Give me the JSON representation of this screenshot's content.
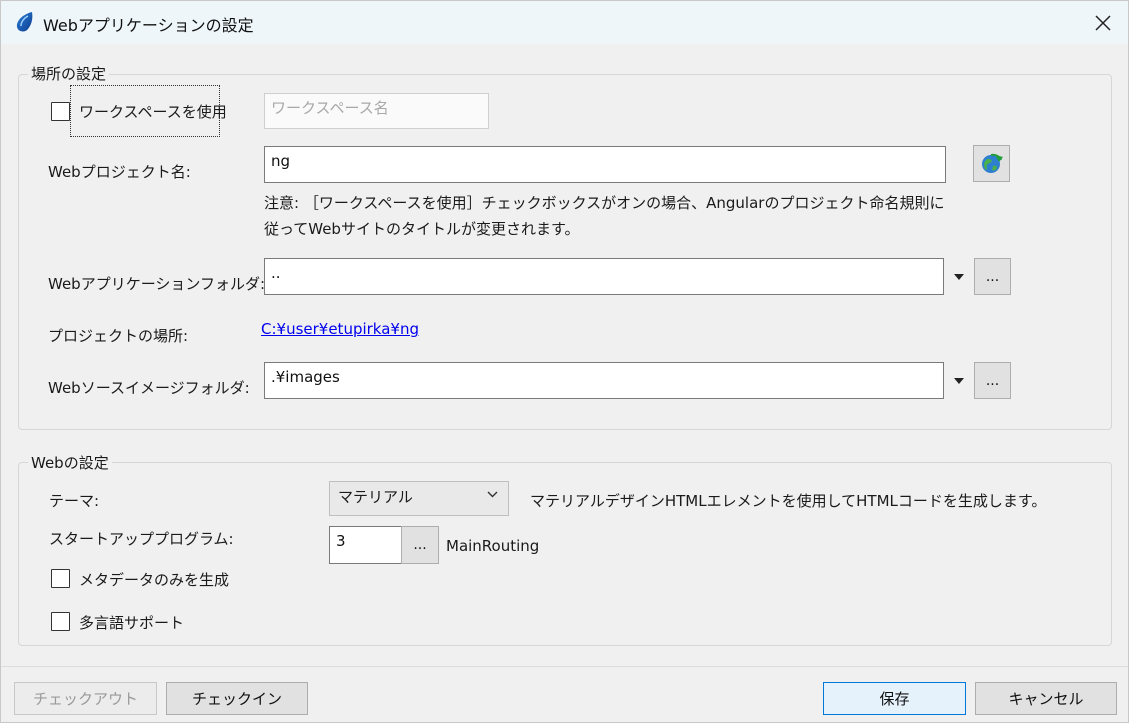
{
  "window": {
    "title": "Webアプリケーションの設定"
  },
  "location_group": {
    "title": "場所の設定",
    "use_workspace_label": "ワークスペースを使用",
    "use_workspace_checked": false,
    "workspace_name_placeholder": "ワークスペース名",
    "web_project_name_label": "Webプロジェクト名:",
    "web_project_name_value": "ng",
    "note_line1": "注意: ［ワークスペースを使用］チェックボックスがオンの場合、Angularのプロジェクト命名規則に",
    "note_line2": "従ってWebサイトのタイトルが変更されます。",
    "app_folder_label": "Webアプリケーションフォルダ:",
    "app_folder_value": "..",
    "project_location_label": "プロジェクトの場所:",
    "project_location_value": "C:¥user¥etupirka¥ng",
    "image_folder_label": "Webソースイメージフォルダ:",
    "image_folder_value": ".¥images",
    "browse_label": "..."
  },
  "web_group": {
    "title": "Webの設定",
    "theme_label": "テーマ:",
    "theme_value": "マテリアル",
    "theme_description": "マテリアルデザインHTMLエレメントを使用してHTMLコードを生成します。",
    "startup_label": "スタートアッププログラム:",
    "startup_value": "3",
    "startup_browse": "...",
    "startup_name": "MainRouting",
    "metadata_only_label": "メタデータのみを生成",
    "metadata_only_checked": false,
    "multilang_label": "多言語サポート",
    "multilang_checked": false
  },
  "footer": {
    "checkout_label": "チェックアウト",
    "checkin_label": "チェックイン",
    "save_label": "保存",
    "cancel_label": "キャンセル"
  },
  "colors": {
    "accent": "#0078d7",
    "link": "#0000ee",
    "titlebar": "#eef6f9"
  },
  "icons": {
    "app": "droplet-icon",
    "close": "close-icon",
    "refresh": "globe-refresh-icon",
    "dropdown": "chevron-down-icon"
  }
}
